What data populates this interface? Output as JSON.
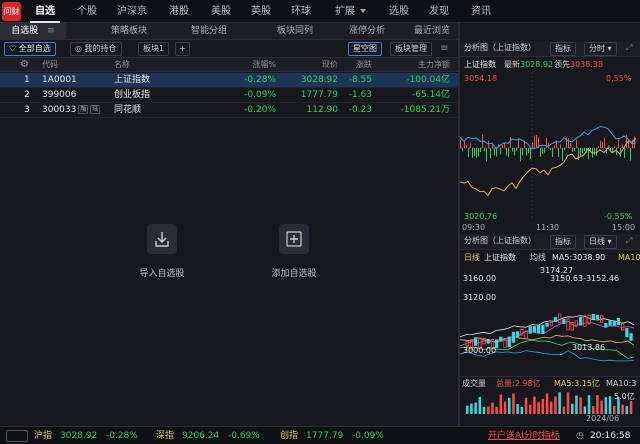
{
  "logo": {
    "text": "问财"
  },
  "top_nav": [
    "自选",
    "个股",
    "沪深京",
    "港股",
    "美股",
    "英股",
    "环球",
    "扩展",
    "选股",
    "发现",
    "资讯"
  ],
  "sub_tabs": [
    "自选股",
    "策略板块",
    "智能分组",
    "板块同列",
    "涨停分析",
    "最近浏览"
  ],
  "toolbar": {
    "all_label": "全部自选",
    "holding_label": "我的持仓",
    "board_label": "板块1",
    "add_label": "+",
    "star_label": "星空图",
    "manage_label": "板块管理"
  },
  "table": {
    "columns": [
      "代码",
      "名称",
      "涨幅%",
      "现价",
      "涨跌",
      "主力净额"
    ],
    "rows": [
      {
        "idx": "1",
        "code": "1A0001",
        "name": "上证指数",
        "pct": "-0.28%",
        "price": "3028.92",
        "chg": "-8.55",
        "net": "-100.04亿",
        "tags": []
      },
      {
        "idx": "2",
        "code": "399006",
        "name": "创业板指",
        "pct": "-0.09%",
        "price": "1777.79",
        "chg": "-1.63",
        "net": "-65.14亿",
        "tags": []
      },
      {
        "idx": "3",
        "code": "300033",
        "name": "同花顺",
        "pct": "-0.20%",
        "price": "112.90",
        "chg": "-0.23",
        "net": "-1085.21万",
        "tags": [
          "融",
          "陆"
        ]
      }
    ]
  },
  "empty_actions": {
    "import_label": "导入自选股",
    "add_label": "添加自选股"
  },
  "intraday": {
    "title": "分析图（上证指数）",
    "indicator_label": "指标",
    "period_label": "分时",
    "index_name": "上证指数",
    "latest_label": "最新",
    "latest": "3028.92",
    "lead_label": "领先",
    "lead": "3038.38",
    "price_high": "3054.18",
    "price_low": "3020.76",
    "pct_high": "0.55%",
    "pct_low": "-0.55%",
    "times": [
      "09:30",
      "11:30",
      "15:00"
    ]
  },
  "kline": {
    "title": "分析图（上证指数）",
    "indicator_label": "指标",
    "period_label": "日线",
    "daily_label": "日线",
    "index_name": "上证指数",
    "ma_label": "均线",
    "ma5_label": "MA5:3038.90",
    "ma10_label": "MA10",
    "axis_top": "3160.00",
    "axis_mid": "3120.00",
    "axis_bottom": "3000.00",
    "high_mark": "3174.27",
    "range_mark": "3150.63-3152.46",
    "low_mark": "3013.86",
    "vol_label": "成交量",
    "total_label": "总量:2.98亿",
    "vol_ma5_label": "MA5:3.15亿",
    "vol_ma10_label": "MA10:3",
    "vol_axis": "5.0亿",
    "date": "2024/06"
  },
  "statusbar": {
    "sh_label": "沪指",
    "sh_val": "3028.92",
    "sh_pct": "-0.28%",
    "sz_label": "深指",
    "sz_val": "9206.24",
    "sz_pct": "-0.69%",
    "cy_label": "创指",
    "cy_val": "1777.79",
    "cy_pct": "-0.09%",
    "promo": "开户送AI分时指标",
    "time": "20:16:58"
  },
  "colors": {
    "up": "#ff4a4a",
    "down": "#2fd05a",
    "accent": "#3c7bd8",
    "bg": "#16181d"
  }
}
